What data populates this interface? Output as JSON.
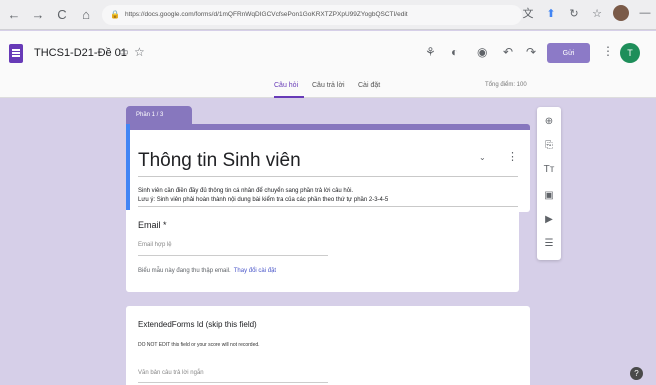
{
  "browser": {
    "back_icon": "←",
    "forward_icon": "→",
    "reload_icon": "C",
    "home_icon": "⌂",
    "lock_icon": "🔒",
    "url": "https://docs.google.com/forms/d/1mQFRnWqDIGCVcfsePon1GoKRXTZPXpU99ZYogbQSCTI/edit",
    "translate_icon": "文",
    "extension_icon": "⬆",
    "refresh2_icon": "↻",
    "bookmark_icon": "☆",
    "menu_icon": "—"
  },
  "header": {
    "title": "THCS1-D21-Đề 01",
    "folder_icon": "▭",
    "star_icon": "☆",
    "addon_icon": "⚘",
    "palette_icon": "◐",
    "preview_icon": "◉",
    "undo_icon": "↶",
    "redo_icon": "↷",
    "send_label": "Gửi",
    "more_icon": "⋮",
    "avatar_letter": "T",
    "accent": "#673ab7"
  },
  "tabs": {
    "items": [
      {
        "label": "Câu hỏi"
      },
      {
        "label": "Câu trả lời"
      },
      {
        "label": "Cài đặt"
      }
    ],
    "score": "Tổng điểm: 100"
  },
  "section": {
    "chip": "Phần 1 / 3",
    "title": "Thông tin Sinh viên",
    "collapse_icon": "⌄",
    "more_icon": "⋮",
    "desc_line1": "Sinh viên cần điền đầy đủ thông tin cá nhân để chuyển sang phần trả lời câu hỏi.",
    "desc_line2": "Lưu ý: Sinh viên phải hoàn thành nội dung bài kiểm tra của các phần theo thứ tự phần 2-3-4-5"
  },
  "email_question": {
    "title": "Email *",
    "placeholder": "Email hợp lệ",
    "collect_note": "Biểu mẫu này đang thu thập email.",
    "collect_link": "Thay đổi cài đặt"
  },
  "extended_question": {
    "title": "ExtendedForms Id (skip this field)",
    "warning": "DO NOT EDIT this field or your score will not recorded.",
    "answer_placeholder": "Văn bản câu trả lời ngắn"
  },
  "toolbar": {
    "add_icon": "⊕",
    "import_icon": "⎘",
    "title_icon": "Tт",
    "image_icon": "▣",
    "video_icon": "▶",
    "section_icon": "☰"
  },
  "help_icon": "?"
}
